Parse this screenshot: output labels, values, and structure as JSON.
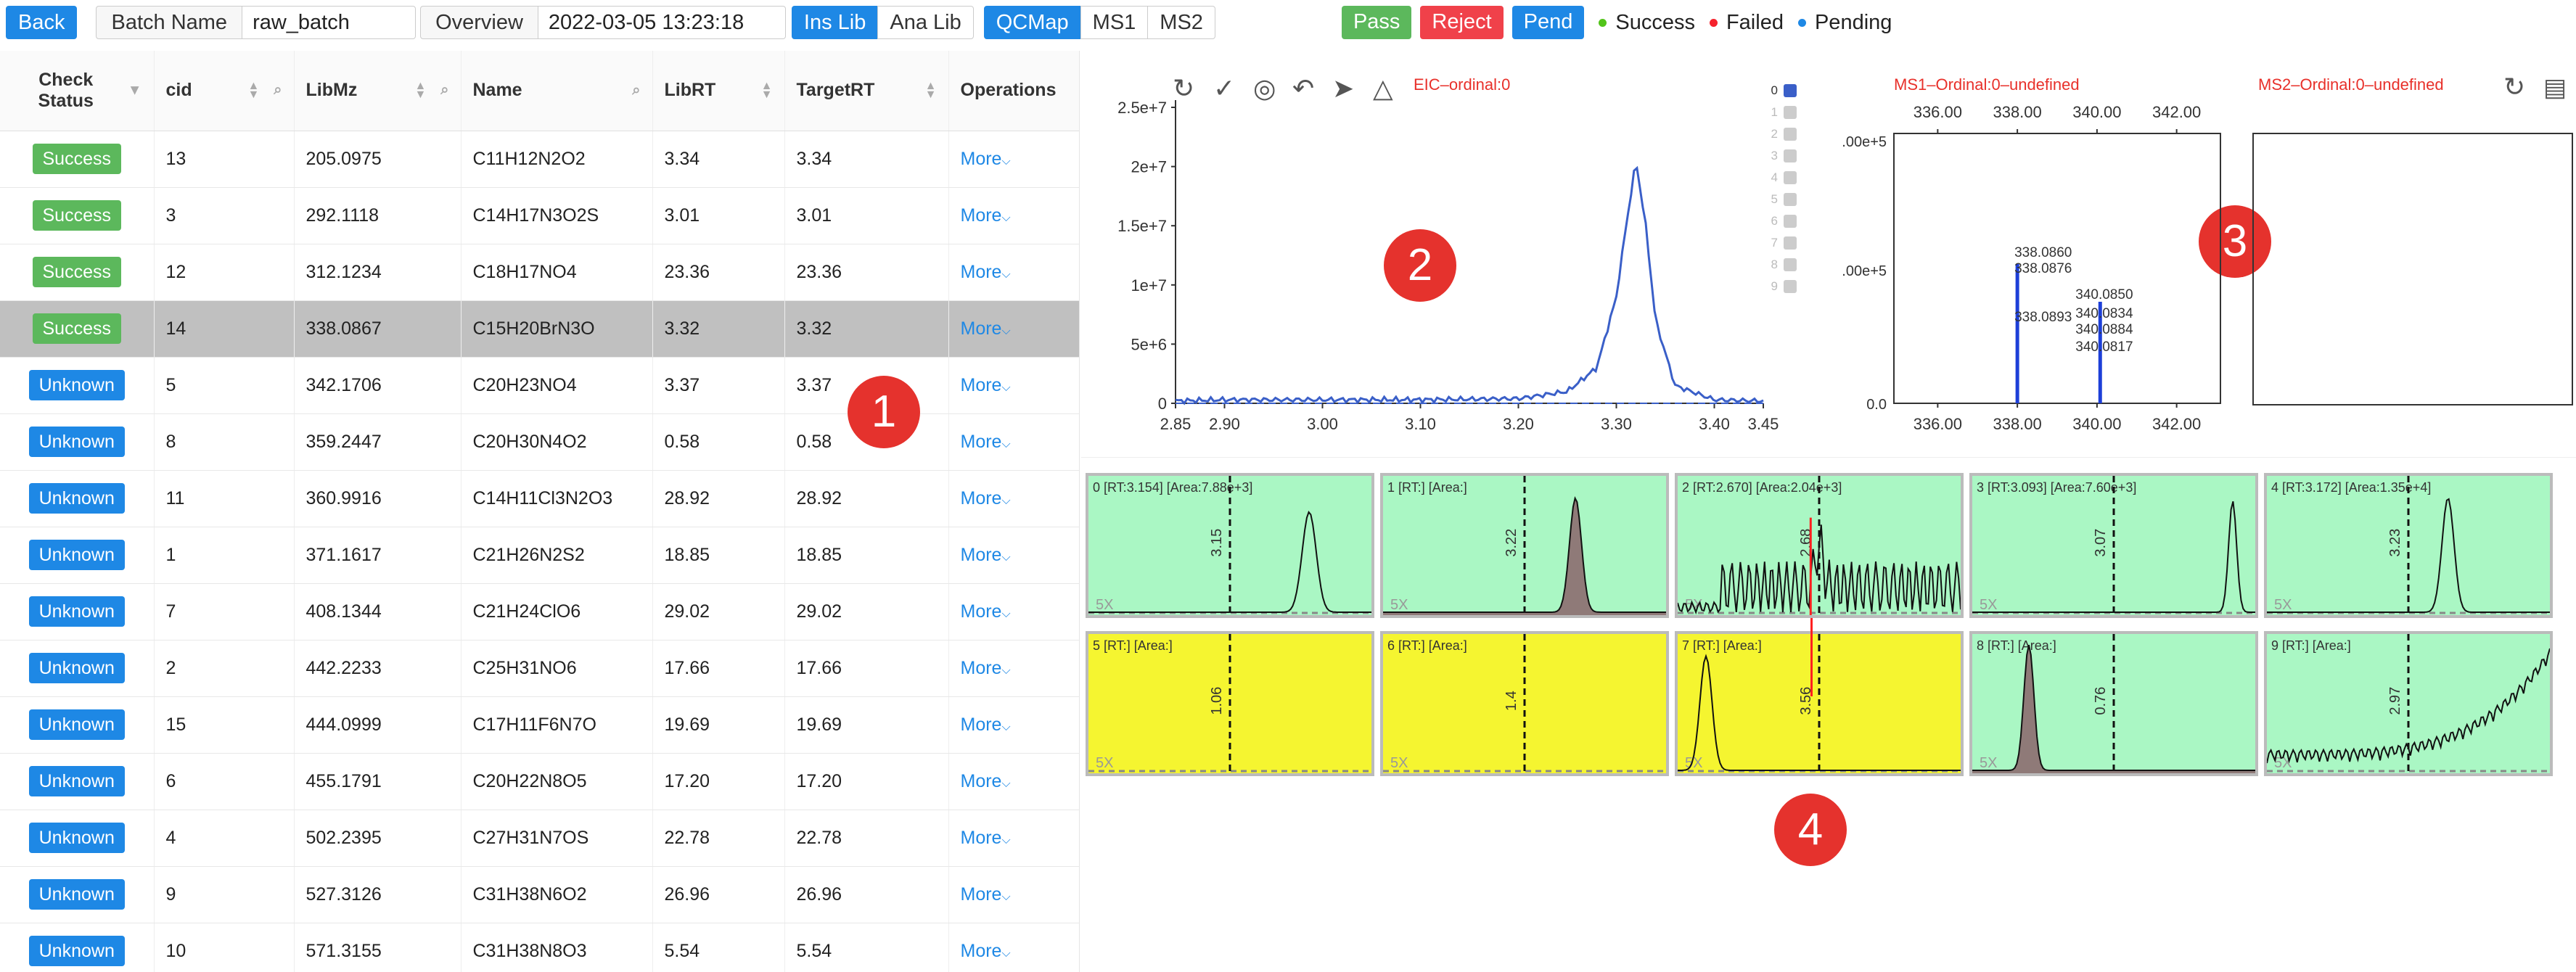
{
  "toolbar": {
    "back": "Back",
    "batch_name_label": "Batch Name",
    "batch_name_value": "raw_batch",
    "overview": "Overview",
    "timestamp": "2022-03-05 13:23:18",
    "lib_tabs": [
      "Ins Lib",
      "Ana Lib"
    ],
    "view_tabs": [
      "QCMap",
      "MS1",
      "MS2"
    ],
    "pass": "Pass",
    "reject": "Reject",
    "pend": "Pend",
    "legend": [
      {
        "label": "Success",
        "color": "#52c41a"
      },
      {
        "label": "Failed",
        "color": "#f5222d"
      },
      {
        "label": "Pending",
        "color": "#1e88e5"
      }
    ]
  },
  "table": {
    "columns": [
      "Check Status",
      "cid",
      "LibMz",
      "Name",
      "LibRT",
      "TargetRT",
      "Operations"
    ],
    "rows": [
      {
        "status": "Success",
        "cid": "13",
        "libmz": "205.0975",
        "name": "C11H12N2O2",
        "librt": "3.34",
        "targetrt": "3.34",
        "op": "More"
      },
      {
        "status": "Success",
        "cid": "3",
        "libmz": "292.1118",
        "name": "C14H17N3O2S",
        "librt": "3.01",
        "targetrt": "3.01",
        "op": "More"
      },
      {
        "status": "Success",
        "cid": "12",
        "libmz": "312.1234",
        "name": "C18H17NO4",
        "librt": "23.36",
        "targetrt": "23.36",
        "op": "More"
      },
      {
        "status": "Success",
        "cid": "14",
        "libmz": "338.0867",
        "name": "C15H20BrN3O",
        "librt": "3.32",
        "targetrt": "3.32",
        "op": "More",
        "selected": true
      },
      {
        "status": "Unknown",
        "cid": "5",
        "libmz": "342.1706",
        "name": "C20H23NO4",
        "librt": "3.37",
        "targetrt": "3.37",
        "op": "More"
      },
      {
        "status": "Unknown",
        "cid": "8",
        "libmz": "359.2447",
        "name": "C20H30N4O2",
        "librt": "0.58",
        "targetrt": "0.58",
        "op": "More"
      },
      {
        "status": "Unknown",
        "cid": "11",
        "libmz": "360.9916",
        "name": "C14H11Cl3N2O3",
        "librt": "28.92",
        "targetrt": "28.92",
        "op": "More"
      },
      {
        "status": "Unknown",
        "cid": "1",
        "libmz": "371.1617",
        "name": "C21H26N2S2",
        "librt": "18.85",
        "targetrt": "18.85",
        "op": "More"
      },
      {
        "status": "Unknown",
        "cid": "7",
        "libmz": "408.1344",
        "name": "C21H24ClO6",
        "librt": "29.02",
        "targetrt": "29.02",
        "op": "More"
      },
      {
        "status": "Unknown",
        "cid": "2",
        "libmz": "442.2233",
        "name": "C25H31NO6",
        "librt": "17.66",
        "targetrt": "17.66",
        "op": "More"
      },
      {
        "status": "Unknown",
        "cid": "15",
        "libmz": "444.0999",
        "name": "C17H11F6N7O",
        "librt": "19.69",
        "targetrt": "19.69",
        "op": "More"
      },
      {
        "status": "Unknown",
        "cid": "6",
        "libmz": "455.1791",
        "name": "C20H22N8O5",
        "librt": "17.20",
        "targetrt": "17.20",
        "op": "More"
      },
      {
        "status": "Unknown",
        "cid": "4",
        "libmz": "502.2395",
        "name": "C27H31N7OS",
        "librt": "22.78",
        "targetrt": "22.78",
        "op": "More"
      },
      {
        "status": "Unknown",
        "cid": "9",
        "libmz": "527.3126",
        "name": "C31H38N6O2",
        "librt": "26.96",
        "targetrt": "26.96",
        "op": "More"
      },
      {
        "status": "Unknown",
        "cid": "10",
        "libmz": "571.3155",
        "name": "C31H38N8O3",
        "librt": "5.54",
        "targetrt": "5.54",
        "op": "More"
      }
    ]
  },
  "markers": [
    "1",
    "2",
    "3",
    "4"
  ],
  "eic": {
    "title": "EIC–ordinal:0",
    "y_ticks": [
      "2.5e+7",
      "2e+7",
      "1.5e+7",
      "1e+7",
      "5e+6",
      "0"
    ],
    "x_ticks": [
      "2.85",
      "2.90",
      "3.00",
      "3.10",
      "3.20",
      "3.30",
      "3.40",
      "3.45"
    ],
    "legend_indices": [
      "0",
      "1",
      "2",
      "3",
      "4",
      "5",
      "6",
      "7",
      "8",
      "9"
    ]
  },
  "ms1": {
    "title": "MS1–Ordinal:0–undefined",
    "x_ticks": [
      "336.00",
      "338.00",
      "340.00",
      "342.00"
    ],
    "y_ticks": [
      ".00e+5",
      ".00e+5",
      "0.0"
    ],
    "peak_labels_a": [
      "338.0860",
      "338.0876",
      "338.0893"
    ],
    "peak_labels_b": [
      "340.0850",
      "340.0834",
      "340.0884",
      "340.0817"
    ]
  },
  "ms2": {
    "title": "MS2–Ordinal:0–undefined"
  },
  "chart_data": {
    "type": "line",
    "title": "EIC–ordinal:0",
    "xlabel": "",
    "ylabel": "",
    "xlim": [
      2.85,
      3.45
    ],
    "ylim": [
      0,
      25000000
    ],
    "series": [
      {
        "x": [
          2.85,
          2.9,
          3.0,
          3.1,
          3.2,
          3.25,
          3.28,
          3.3,
          3.31,
          3.32,
          3.33,
          3.34,
          3.36,
          3.4,
          3.45
        ],
        "y": [
          200000,
          300000,
          300000,
          300000,
          400000,
          1000000,
          3000000,
          9000000,
          15000000,
          20500000,
          15000000,
          7000000,
          1500000,
          300000,
          200000
        ]
      }
    ]
  },
  "grid": {
    "cells": [
      {
        "header": "0 [RT:3.154] [Area:7.88e+3]",
        "marker": "3.15",
        "bg": "#aaf7c4"
      },
      {
        "header": "1 [RT:] [Area:]",
        "marker": "3.22",
        "bg": "#aaf7c4"
      },
      {
        "header": "2 [RT:2.670] [Area:2.04e+3]",
        "marker": "2.68",
        "bg": "#aaf7c4"
      },
      {
        "header": "3 [RT:3.093] [Area:7.60e+3]",
        "marker": "3.07",
        "bg": "#aaf7c4"
      },
      {
        "header": "4 [RT:3.172] [Area:1.35e+4]",
        "marker": "3.23",
        "bg": "#aaf7c4"
      },
      {
        "header": "5 [RT:] [Area:]",
        "marker": "1.06",
        "bg": "#f5f530"
      },
      {
        "header": "6 [RT:] [Area:]",
        "marker": "1.4",
        "bg": "#f5f530"
      },
      {
        "header": "7 [RT:] [Area:]",
        "marker": "3.56",
        "bg": "#f5f530"
      },
      {
        "header": "8 [RT:] [Area:]",
        "marker": "0.76",
        "bg": "#aaf7c4"
      },
      {
        "header": "9 [RT:] [Area:]",
        "marker": "2.97",
        "bg": "#aaf7c4"
      }
    ],
    "scale_label": "5X"
  }
}
